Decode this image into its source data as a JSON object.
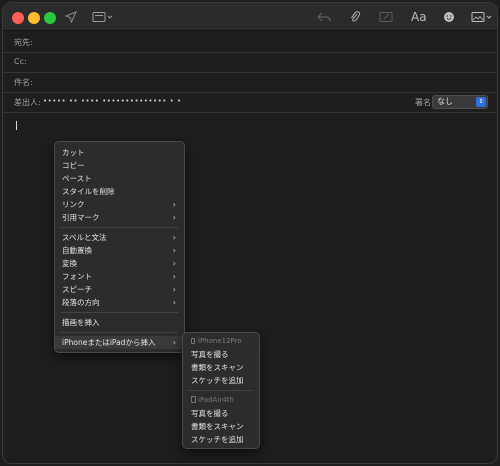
{
  "toolbar": {
    "font_button_label": "Aa"
  },
  "fields": {
    "to_label": "宛先:",
    "cc_label": "Cc:",
    "subject_label": "件名:",
    "from_label": "差出人:",
    "from_value": "••••• •• •••• •••••••••••••• • •",
    "signature_label": "署名:",
    "signature_value": "なし"
  },
  "context_menu": {
    "items": [
      {
        "label": "カット"
      },
      {
        "label": "コピー"
      },
      {
        "label": "ペースト"
      },
      {
        "label": "スタイルを削除"
      },
      {
        "label": "リンク",
        "submenu": true
      },
      {
        "label": "引用マーク",
        "submenu": true
      },
      {
        "label": "スペルと文法",
        "submenu": true
      },
      {
        "label": "自動置換",
        "submenu": true
      },
      {
        "label": "変換",
        "submenu": true
      },
      {
        "label": "フォント",
        "submenu": true
      },
      {
        "label": "スピーチ",
        "submenu": true
      },
      {
        "label": "段落の方向",
        "submenu": true
      },
      {
        "label": "描画を挿入"
      },
      {
        "label": "iPhoneまたはiPadから挿入",
        "submenu": true
      }
    ]
  },
  "continuity_submenu": {
    "device1": "iPhone12Pro",
    "device1_items": [
      "写真を撮る",
      "書類をスキャン",
      "スケッチを追加"
    ],
    "device2": "iPadAir4th",
    "device2_items": [
      "写真を撮る",
      "書類をスキャン",
      "スケッチを追加"
    ]
  },
  "colors": {
    "window_bg": "#1e1e1e",
    "menu_bg": "#2c2c2e",
    "accent": "#2f6fe0"
  }
}
